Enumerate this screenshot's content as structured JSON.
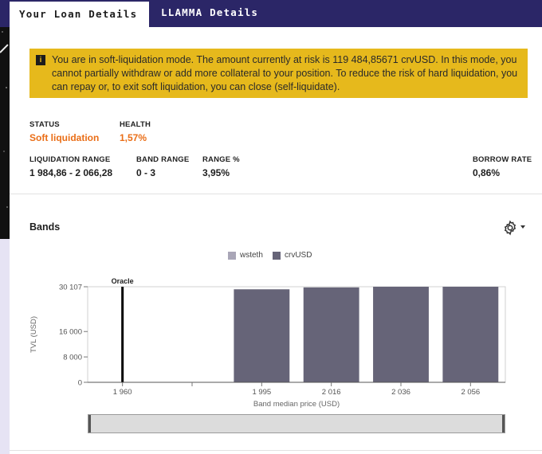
{
  "tabs": {
    "loan_details": "Your Loan Details",
    "llamma_details": "LLAMMA Details"
  },
  "alert": {
    "icon": "info-icon",
    "text": "You are in soft-liquidation mode. The amount currently at risk is 119 484,85671 crvUSD. In this mode, you cannot partially withdraw or add more collateral to your position. To reduce the risk of hard liquidation, you can repay or, to exit soft liquidation, you can close (self-liquidate)."
  },
  "details": {
    "status_label": "STATUS",
    "status_value": "Soft liquidation",
    "health_label": "HEALTH",
    "health_value": "1,57%",
    "liq_range_label": "LIQUIDATION RANGE",
    "liq_range_value": "1 984,86 - 2 066,28",
    "band_range_label": "BAND RANGE",
    "band_range_value": "0 - 3",
    "range_pct_label": "RANGE %",
    "range_pct_value": "3,95%",
    "borrow_rate_label": "BORROW RATE",
    "borrow_rate_value": "0,86%"
  },
  "bands": {
    "title": "Bands",
    "settings_icon": "gear-icon"
  },
  "colors": {
    "accent_orange": "#ea6e17",
    "alert_bg": "#e6b91c",
    "tab_bar": "#2b2667",
    "series_wsteth": "#a9a6b7",
    "series_crvusd": "#666478"
  },
  "chart_data": {
    "type": "bar",
    "categories": [
      "1 960",
      "",
      "1 995",
      "2 016",
      "2 036",
      "2 056"
    ],
    "series": [
      {
        "name": "wsteth",
        "values": [
          0,
          0,
          0,
          0,
          0,
          0
        ]
      },
      {
        "name": "crvUSD",
        "values": [
          0,
          0,
          29300,
          29900,
          30107,
          30107
        ]
      }
    ],
    "xlabel": "Band median price (USD)",
    "ylabel": "TVL (USD)",
    "yticks": [
      "0",
      "8 000",
      "16 000",
      "30 107"
    ],
    "ytick_values": [
      0,
      8000,
      16000,
      30107
    ],
    "ylim": [
      0,
      30107
    ],
    "oracle_label": "Oracle",
    "oracle_category": "1 960",
    "legend": "top-center",
    "grid": false
  }
}
